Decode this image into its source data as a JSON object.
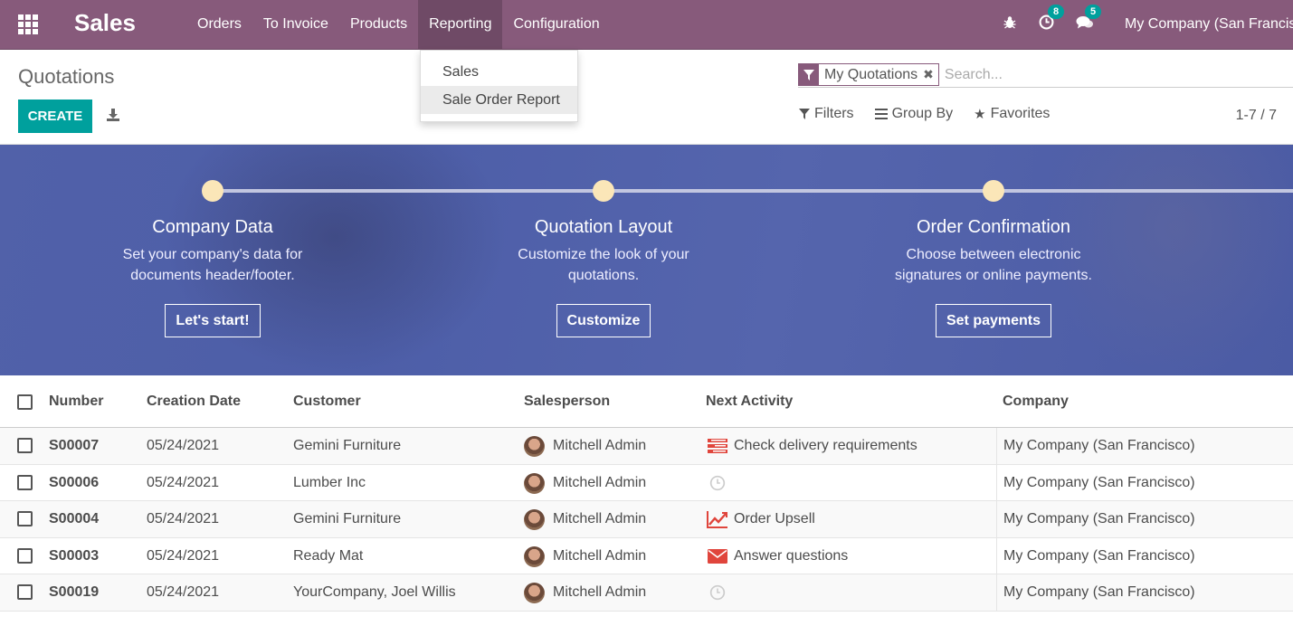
{
  "navbar": {
    "brand": "Sales",
    "menu": [
      "Orders",
      "To Invoice",
      "Products",
      "Reporting",
      "Configuration"
    ],
    "active_menu": "Reporting",
    "activity_count": "8",
    "messages_count": "5",
    "company": "My Company (San Francisco)"
  },
  "reporting_dropdown": {
    "items": [
      "Sales",
      "Sale Order Report"
    ],
    "highlighted": "Sale Order Report"
  },
  "control_panel": {
    "breadcrumb": "Quotations",
    "create_label": "CREATE",
    "facet": "My Quotations",
    "search_placeholder": "Search...",
    "filters_label": "Filters",
    "group_by_label": "Group By",
    "favorites_label": "Favorites",
    "pager": "1-7 / 7"
  },
  "onboarding": {
    "steps": [
      {
        "title": "Company Data",
        "description_lines": [
          "Set your company's data for",
          "documents header/footer."
        ],
        "button": "Let's start!"
      },
      {
        "title": "Quotation Layout",
        "description_lines": [
          "Customize the look of your",
          "quotations."
        ],
        "button": "Customize"
      },
      {
        "title": "Order Confirmation",
        "description_lines": [
          "Choose between electronic",
          "signatures or online payments."
        ],
        "button": "Set payments"
      }
    ]
  },
  "table": {
    "columns": [
      "Number",
      "Creation Date",
      "Customer",
      "Salesperson",
      "Next Activity",
      "Company"
    ],
    "rows": [
      {
        "number": "S00007",
        "date": "05/24/2021",
        "customer": "Gemini Furniture",
        "salesperson": "Mitchell Admin",
        "activity": "Check delivery requirements",
        "activity_icon": "tasks-icon",
        "company": "My Company (San Francisco)"
      },
      {
        "number": "S00006",
        "date": "05/24/2021",
        "customer": "Lumber Inc",
        "salesperson": "Mitchell Admin",
        "activity": "",
        "activity_icon": "clock-icon",
        "company": "My Company (San Francisco)"
      },
      {
        "number": "S00004",
        "date": "05/24/2021",
        "customer": "Gemini Furniture",
        "salesperson": "Mitchell Admin",
        "activity": "Order Upsell",
        "activity_icon": "line-chart-icon",
        "company": "My Company (San Francisco)"
      },
      {
        "number": "S00003",
        "date": "05/24/2021",
        "customer": "Ready Mat",
        "salesperson": "Mitchell Admin",
        "activity": "Answer questions",
        "activity_icon": "envelope-icon",
        "company": "My Company (San Francisco)"
      },
      {
        "number": "S00019",
        "date": "05/24/2021",
        "customer": "YourCompany, Joel Willis",
        "salesperson": "Mitchell Admin",
        "activity": "",
        "activity_icon": "clock-icon",
        "company": "My Company (San Francisco)"
      }
    ]
  },
  "colors": {
    "brand": "#875a7b",
    "primary": "#00a09d",
    "banner": "#5161a9",
    "activity_red": "#e0453c"
  }
}
